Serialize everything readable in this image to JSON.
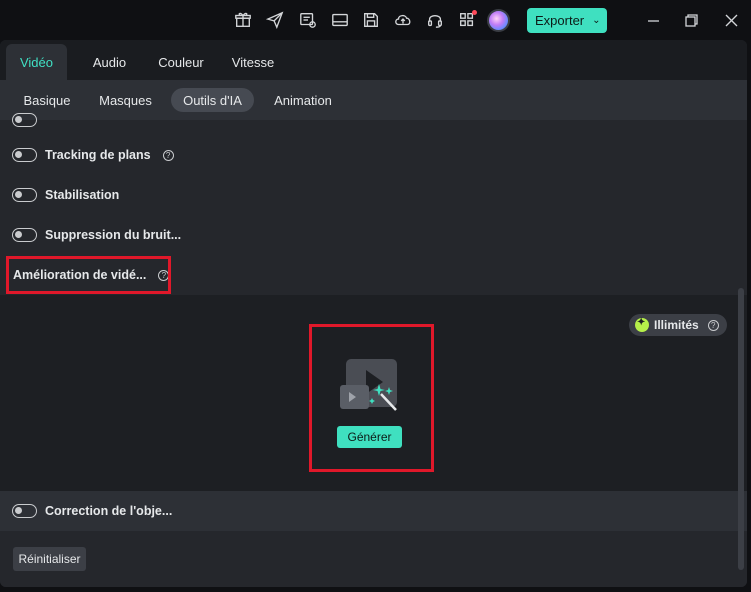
{
  "titlebar": {
    "icons": [
      "gift-icon",
      "send-icon",
      "media-settings-icon",
      "layout-icon",
      "save-icon",
      "cloud-upload-icon",
      "headset-icon",
      "apps-grid-icon"
    ],
    "export_label": "Exporter"
  },
  "tabs": [
    {
      "label": "Vidéo",
      "active": true
    },
    {
      "label": "Audio",
      "active": false
    },
    {
      "label": "Couleur",
      "active": false
    },
    {
      "label": "Vitesse",
      "active": false
    }
  ],
  "subtabs": [
    {
      "label": "Basique",
      "active": false
    },
    {
      "label": "Masques",
      "active": false
    },
    {
      "label": "Outils d'IA",
      "active": true
    },
    {
      "label": "Animation",
      "active": false
    }
  ],
  "features": {
    "tracking": "Tracking de plans",
    "stabilisation": "Stabilisation",
    "noise": "Suppression du bruit...",
    "enhancement": "Amélioration de vidé...",
    "lens": "Correction de l'obje..."
  },
  "ai_panel": {
    "badge_label": "Illimités",
    "generate_label": "Générer"
  },
  "footer": {
    "reset_label": "Réinitialiser"
  },
  "colors": {
    "accent": "#3fe0c0",
    "highlight": "#e0182a"
  }
}
